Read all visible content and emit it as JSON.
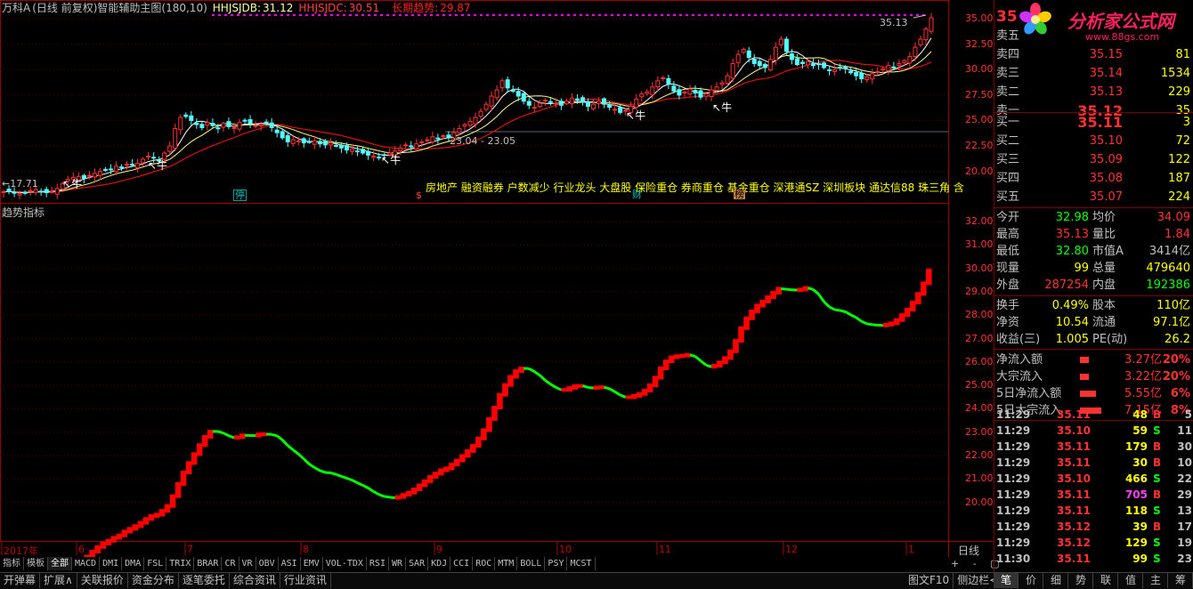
{
  "header": {
    "stock": "万科A",
    "mode": "(日线 前复权)",
    "indicator": "智能辅助主图(180,10)",
    "hhjsjdb_label": "HHJSJDB:",
    "hhjsjdb_value": "31.12",
    "hhjsjdc_label": "HHJSJDC:",
    "hhjsjdc_value": "30.51",
    "trend_label": "长期趋势:",
    "trend_value": "29.87"
  },
  "chart_data": [
    {
      "type": "candlestick",
      "yaxis_ticks": [
        "35.00",
        "32.50",
        "30.00",
        "27.50",
        "25.00",
        "22.50",
        "20.00"
      ],
      "ylim": [
        18.3,
        36.5
      ],
      "x_dates": [
        "2017年",
        "6",
        "7",
        "8",
        "9",
        "10",
        "11",
        "12",
        "1"
      ],
      "close": [
        18.0,
        18.0,
        17.9,
        17.8,
        17.9,
        18.1,
        18.2,
        18.0,
        17.9,
        18.0,
        18.3,
        18.8,
        19.2,
        19.4,
        19.5,
        19.3,
        19.6,
        19.8,
        20.0,
        20.1,
        20.2,
        20.5,
        20.4,
        20.7,
        20.6,
        20.8,
        21.2,
        21.5,
        21.3,
        21.0,
        21.8,
        22.5,
        24.2,
        25.3,
        25.4,
        25.0,
        24.6,
        24.3,
        24.8,
        24.5,
        24.2,
        24.7,
        24.4,
        24.3,
        24.8,
        25.0,
        24.7,
        24.5,
        24.6,
        24.8,
        24.3,
        23.8,
        23.3,
        22.9,
        23.1,
        23.0,
        22.8,
        22.9,
        23.0,
        22.7,
        22.6,
        22.8,
        22.5,
        22.3,
        22.1,
        22.2,
        22.0,
        21.8,
        21.6,
        21.5,
        21.4,
        21.6,
        21.8,
        22.0,
        22.3,
        22.6,
        22.4,
        22.7,
        22.9,
        23.1,
        23.4,
        23.2,
        23.5,
        23.3,
        23.8,
        24.2,
        24.6,
        24.9,
        25.3,
        25.9,
        26.6,
        27.4,
        28.0,
        28.9,
        28.2,
        27.9,
        27.4,
        26.9,
        26.5,
        26.3,
        26.7,
        27.0,
        26.8,
        26.7,
        26.5,
        26.9,
        27.2,
        27.0,
        26.8,
        26.4,
        26.6,
        26.9,
        26.6,
        26.3,
        26.1,
        25.8,
        26.0,
        26.4,
        27.1,
        27.6,
        27.8,
        28.3,
        28.9,
        29.2,
        28.6,
        27.9,
        27.5,
        27.8,
        28.1,
        27.7,
        27.3,
        27.6,
        28.0,
        28.3,
        28.7,
        29.4,
        30.6,
        31.5,
        32.0,
        31.2,
        30.6,
        30.4,
        30.2,
        31.0,
        32.2,
        33.0,
        31.8,
        31.0,
        30.5,
        30.6,
        30.8,
        30.4,
        30.5,
        30.2,
        29.9,
        30.0,
        30.2,
        30.1,
        29.7,
        29.4,
        29.1,
        29.3,
        29.6,
        29.8,
        30.1,
        30.4,
        30.2,
        30.6,
        30.9,
        31.3,
        32.2,
        33.0,
        34.0,
        35.1
      ],
      "annotations": [
        "35.13",
        "←17.71",
        "23.04 - 23.05",
        "牛",
        "停",
        "$",
        "财",
        "榜"
      ]
    },
    {
      "type": "line",
      "yaxis_ticks": [
        "32.00",
        "31.00",
        "30.00",
        "29.00",
        "28.00",
        "27.00",
        "26.00",
        "25.00",
        "24.00",
        "23.00",
        "22.00",
        "21.00",
        "20.00"
      ],
      "ylim": [
        18.5,
        32.5
      ],
      "title": "趋势指标"
    }
  ],
  "tags": "房地产 融资融券 户数减少 行业龙头 大盘股 保险重仓 券商重仓 基金重仓 深港通SZ 深圳板块 通达信88 珠三角 含",
  "ind_title": "趋势指标",
  "dates": [
    "2017年",
    "6",
    "7",
    "8",
    "9",
    "10",
    "11",
    "12",
    "1"
  ],
  "upper_axis": [
    "35.00",
    "32.50",
    "30.00",
    "27.50",
    "25.00",
    "22.50",
    "20.00"
  ],
  "lower_axis": [
    "32.00",
    "31.00",
    "30.00",
    "29.00",
    "28.00",
    "27.00",
    "26.00",
    "25.00",
    "24.00",
    "23.00",
    "22.00",
    "21.00",
    "20.00"
  ],
  "annots": {
    "high": "35.13",
    "low": "←17.71",
    "range": "23.04 - 23.05",
    "niu": "牛",
    "s1": "停",
    "s2": "$",
    "s3": "财",
    "s4": "榜"
  },
  "quote": {
    "price": "35",
    "asks": [
      {
        "label": "卖五",
        "price": "",
        "vol": ""
      },
      {
        "label": "卖四",
        "price": "35.15",
        "vol": "81"
      },
      {
        "label": "卖三",
        "price": "35.14",
        "vol": "1534"
      },
      {
        "label": "卖二",
        "price": "35.13",
        "vol": "229"
      },
      {
        "label": "卖一",
        "price": "35.12",
        "vol": "35"
      }
    ],
    "bids": [
      {
        "label": "买一",
        "price": "35.11",
        "vol": "3"
      },
      {
        "label": "买二",
        "price": "35.10",
        "vol": "72"
      },
      {
        "label": "买三",
        "price": "35.09",
        "vol": "122"
      },
      {
        "label": "买四",
        "price": "35.08",
        "vol": "187"
      },
      {
        "label": "买五",
        "price": "35.07",
        "vol": "224"
      }
    ],
    "stats": [
      {
        "a": "今开",
        "b": "32.98",
        "bc": "#00ff00",
        "c": "均价",
        "d": "34.09",
        "dc": "#ff3232"
      },
      {
        "a": "最高",
        "b": "35.13",
        "bc": "#ff3232",
        "c": "量比",
        "d": "1.84",
        "dc": "#ff3232"
      },
      {
        "a": "最低",
        "b": "32.80",
        "bc": "#00ff00",
        "c": "市值A",
        "d": "3414亿",
        "dc": "#c0c0c0"
      },
      {
        "a": "现量",
        "b": "99",
        "bc": "#ffff00",
        "c": "总量",
        "d": "479640",
        "dc": "#ffff00"
      },
      {
        "a": "外盘",
        "b": "287254",
        "bc": "#ff3232",
        "c": "内盘",
        "d": "192386",
        "dc": "#00ff00"
      }
    ],
    "fund": [
      {
        "a": "换手",
        "b": "0.49%",
        "c": "股本",
        "d": "110亿"
      },
      {
        "a": "净资",
        "b": "10.54",
        "c": "流通",
        "d": "97.1亿"
      },
      {
        "a": "收益(三)",
        "b": "1.005",
        "c": "PE(动)",
        "d": "26.2"
      }
    ],
    "flows": [
      {
        "a": "净流入额",
        "v": "3.27亿",
        "p": "20%",
        "w": 10
      },
      {
        "a": "大宗流入",
        "v": "3.22亿",
        "p": "20%",
        "w": 10
      },
      {
        "a": "5日净流入额",
        "v": "5.55亿",
        "p": "6%",
        "w": 18
      },
      {
        "a": "5日大宗流入",
        "v": "7.15亿",
        "p": "8%",
        "w": 24
      }
    ],
    "ticks": [
      {
        "t": "11:29",
        "p": "35.11",
        "v": "48",
        "s": "B",
        "n": "5"
      },
      {
        "t": "11:29",
        "p": "35.10",
        "v": "59",
        "s": "S",
        "n": "11"
      },
      {
        "t": "11:29",
        "p": "35.11",
        "v": "179",
        "s": "B",
        "n": "30"
      },
      {
        "t": "11:29",
        "p": "35.11",
        "v": "30",
        "s": "B",
        "n": "10"
      },
      {
        "t": "11:29",
        "p": "35.10",
        "v": "466",
        "s": "S",
        "n": "22"
      },
      {
        "t": "11:29",
        "p": "35.11",
        "v": "705",
        "s": "B",
        "n": "29"
      },
      {
        "t": "11:29",
        "p": "35.11",
        "v": "118",
        "s": "S",
        "n": "13"
      },
      {
        "t": "11:29",
        "p": "35.12",
        "v": "39",
        "s": "B",
        "n": "17"
      },
      {
        "t": "11:29",
        "p": "35.12",
        "v": "129",
        "s": "S",
        "n": "19"
      },
      {
        "t": "11:30",
        "p": "35.11",
        "v": "99",
        "s": "S",
        "n": "23"
      }
    ]
  },
  "tabs": [
    "指标",
    "模板",
    "全部",
    "MACD",
    "DMI",
    "DMA",
    "FSL",
    "TRIX",
    "BRAR",
    "CR",
    "VR",
    "OBV",
    "ASI",
    "EMV",
    "VOL-TDX",
    "RSI",
    "WR",
    "SAR",
    "KDJ",
    "CCI",
    "ROC",
    "MTM",
    "BOLL",
    "PSY",
    "MCST"
  ],
  "period_label": "日线",
  "bottom": [
    "开弹幕",
    "扩展∧",
    "关联报价",
    "资金分布",
    "逐笔委托",
    "综合资讯",
    "行业资讯"
  ],
  "bottom_right": [
    "图文F10",
    "侧边栏<"
  ],
  "nav": [
    "笔",
    "价",
    "细",
    "势",
    "联",
    "值",
    "主",
    "筹"
  ],
  "logo": {
    "title": "分析家公式网",
    "url": "www.88gs.com"
  }
}
